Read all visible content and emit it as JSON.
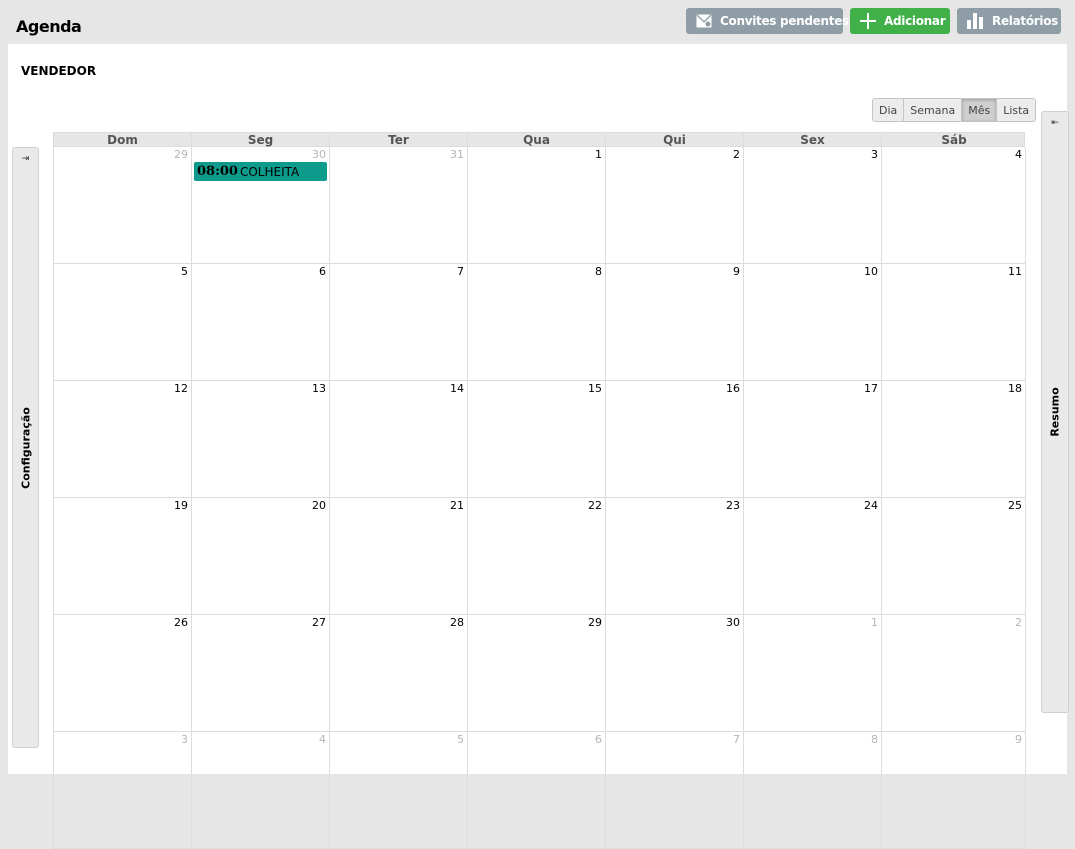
{
  "header": {
    "title": "Agenda",
    "buttons": {
      "convites": "Convites pendentes",
      "adicionar": "Adicionar",
      "relatorios": "Relatórios"
    }
  },
  "section_title": "VENDEDOR",
  "view_switch": [
    "Dia",
    "Semana",
    "Mês",
    "Lista"
  ],
  "active_view": "Mês",
  "side_left": {
    "label": "Configuração",
    "icon": "expand-right-icon"
  },
  "side_right": {
    "label": "Resumo",
    "icon": "expand-left-icon"
  },
  "calendar": {
    "weekdays": [
      "Dom",
      "Seg",
      "Ter",
      "Qua",
      "Qui",
      "Sex",
      "Sáb"
    ],
    "weeks": [
      [
        {
          "d": "29",
          "o": true
        },
        {
          "d": "30",
          "o": true
        },
        {
          "d": "31",
          "o": true
        },
        {
          "d": "1"
        },
        {
          "d": "2"
        },
        {
          "d": "3"
        },
        {
          "d": "4"
        }
      ],
      [
        {
          "d": "5"
        },
        {
          "d": "6"
        },
        {
          "d": "7"
        },
        {
          "d": "8"
        },
        {
          "d": "9"
        },
        {
          "d": "10"
        },
        {
          "d": "11"
        }
      ],
      [
        {
          "d": "12"
        },
        {
          "d": "13"
        },
        {
          "d": "14"
        },
        {
          "d": "15"
        },
        {
          "d": "16"
        },
        {
          "d": "17"
        },
        {
          "d": "18"
        }
      ],
      [
        {
          "d": "19"
        },
        {
          "d": "20"
        },
        {
          "d": "21"
        },
        {
          "d": "22"
        },
        {
          "d": "23"
        },
        {
          "d": "24"
        },
        {
          "d": "25"
        }
      ],
      [
        {
          "d": "26"
        },
        {
          "d": "27"
        },
        {
          "d": "28"
        },
        {
          "d": "29"
        },
        {
          "d": "30"
        },
        {
          "d": "1",
          "o": true
        },
        {
          "d": "2",
          "o": true
        }
      ],
      [
        {
          "d": "3",
          "o": true
        },
        {
          "d": "4",
          "o": true
        },
        {
          "d": "5",
          "o": true
        },
        {
          "d": "6",
          "o": true
        },
        {
          "d": "7",
          "o": true
        },
        {
          "d": "8",
          "o": true
        },
        {
          "d": "9",
          "o": true
        }
      ]
    ],
    "events": [
      {
        "week": 0,
        "day": 1,
        "time": "08:00",
        "title": "COLHEITA",
        "color": "#0d9b8c"
      }
    ]
  },
  "colors": {
    "green": "#41b049",
    "gray_button": "#8e9da6",
    "event": "#0d9b8c"
  }
}
